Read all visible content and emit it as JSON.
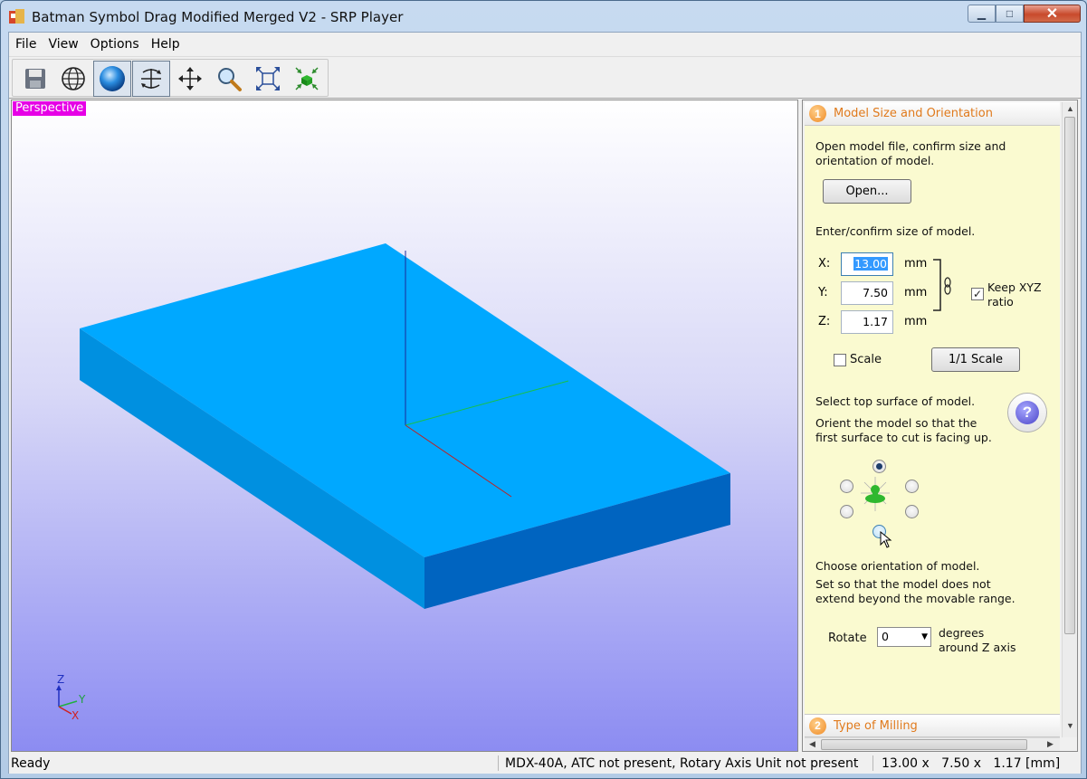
{
  "window": {
    "title": "Batman Symbol Drag Modified Merged V2 - SRP Player",
    "controls": {
      "minimize": "▁",
      "maximize": "□",
      "close": "✕"
    }
  },
  "menu": [
    "File",
    "View",
    "Options",
    "Help"
  ],
  "toolbar": {
    "buttons": [
      {
        "name": "save-icon",
        "pressed": false
      },
      {
        "name": "wireframe-globe-icon",
        "pressed": false
      },
      {
        "name": "shaded-sphere-icon",
        "pressed": true
      },
      {
        "name": "rotate-view-icon",
        "pressed": true
      },
      {
        "name": "pan-view-icon",
        "pressed": false
      },
      {
        "name": "zoom-icon",
        "pressed": false
      },
      {
        "name": "fit-to-window-icon",
        "pressed": false
      },
      {
        "name": "view-model-icon",
        "pressed": false
      }
    ]
  },
  "viewport": {
    "label": "Perspective",
    "model_color": "#00a8ff",
    "axes": {
      "z": "Z",
      "y": "Y",
      "x": "X"
    }
  },
  "panel": {
    "section1": {
      "number": "1",
      "title": "Model Size and Orientation",
      "intro": "Open model file, confirm size and orientation of model.",
      "open_button": "Open...",
      "size_prompt": "Enter/confirm size of model.",
      "x_label": "X:",
      "x_value": "13.00",
      "y_label": "Y:",
      "y_value": "7.50",
      "z_label": "Z:",
      "z_value": "1.17",
      "unit": "mm",
      "keep_ratio_label": "Keep XYZ ratio",
      "keep_ratio_checked": true,
      "scale_label": "Scale",
      "scale_checked": false,
      "one_to_one_button": "1/1 Scale",
      "top_surface_heading": "Select top surface of model.",
      "top_surface_desc": "Orient the model so that the first surface to cut is facing up.",
      "help_icon": "?",
      "orientation_heading": "Choose orientation of model.",
      "orientation_desc": "Set so that the model does not extend beyond the movable range.",
      "rotate_label": "Rotate",
      "rotate_value": "0",
      "rotate_unit": "degrees around Z axis"
    },
    "section2": {
      "number": "2",
      "title": "Type of Milling"
    }
  },
  "status": {
    "state": "Ready",
    "machine": "MDX-40A, ATC not present, Rotary Axis Unit not present",
    "dims": "13.00 x   7.50 x   1.17 [mm]"
  }
}
